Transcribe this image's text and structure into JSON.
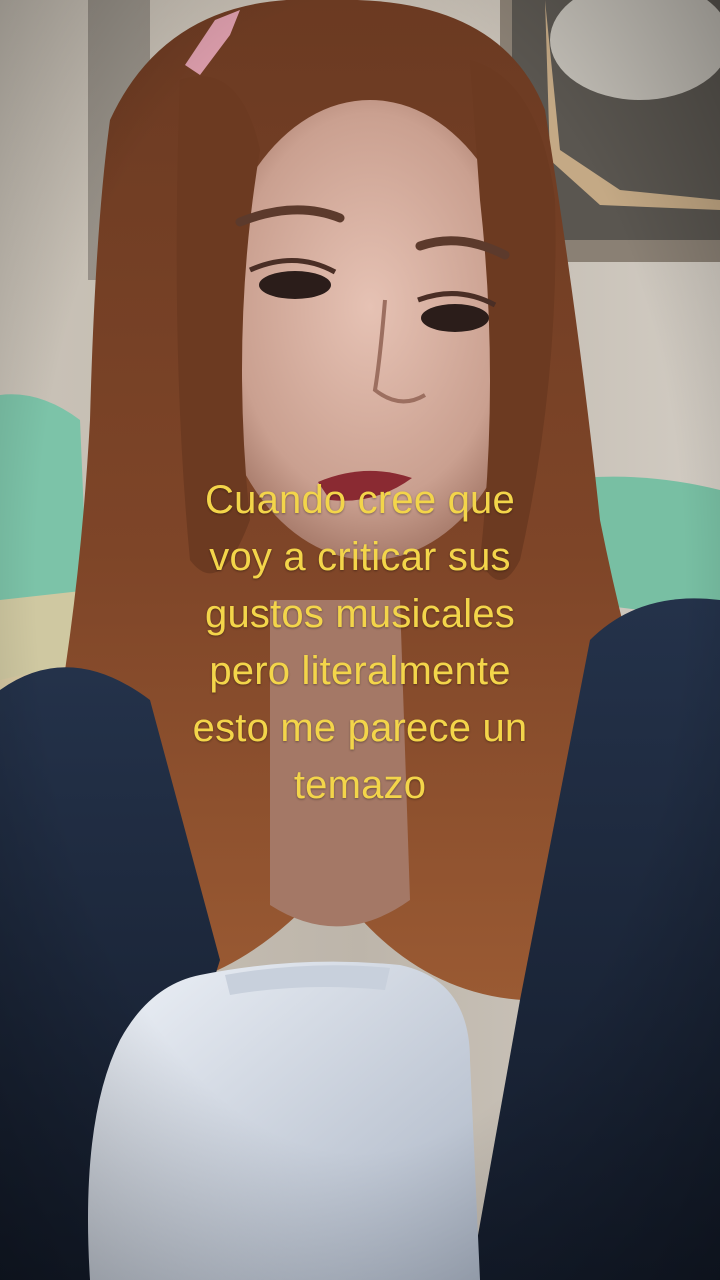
{
  "video": {
    "caption_lines": [
      "Cuando cree que",
      "voy a criticar sus",
      "gustos musicales",
      "pero literalmente",
      "esto me parece un",
      "temazo"
    ]
  },
  "colors": {
    "caption": "#f3d54a",
    "wall": "#cfc9c0",
    "sofa": "#7cc3a8",
    "hair": "#7a3f22",
    "jacket": "#1f2d44",
    "top": "#d9dfe8"
  }
}
